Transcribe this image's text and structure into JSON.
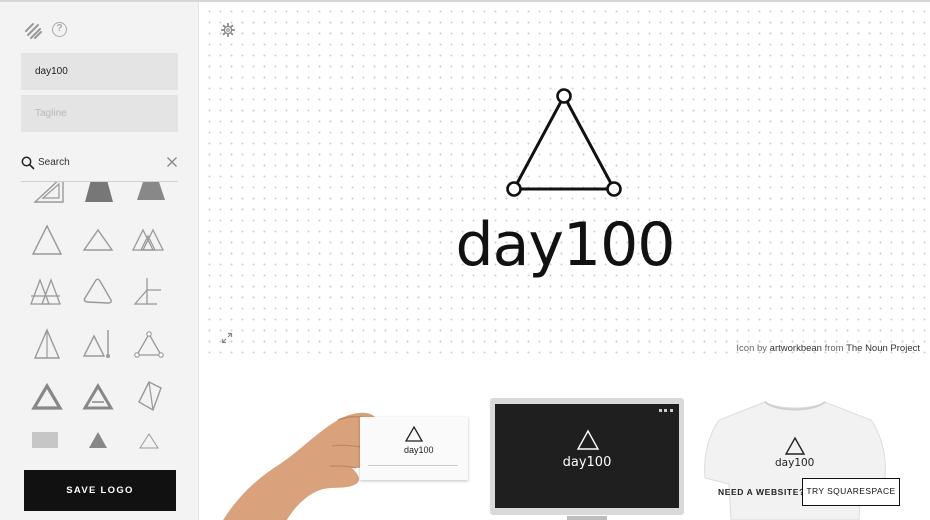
{
  "sidebar": {
    "brand_icon": "squarespace-logo-icon",
    "help_label": "?",
    "logo_name_value": "day100",
    "tagline_placeholder": "Tagline",
    "search_label": "Search",
    "save_label": "SAVE LOGO",
    "icon_grid": [
      "triangle-ruler-icon",
      "solid-trapezoid-icon",
      "solid-triangle-icon",
      "triangle-outline-icon",
      "triangle-outline-wide-icon",
      "overlapping-triangles-icon",
      "stacked-triangles-icon",
      "rounded-triangle-icon",
      "triangle-corner-icon",
      "split-triangle-icon",
      "triangle-measure-icon",
      "triangle-nodes-icon",
      "bold-triangle-icon",
      "bold-triangle-alt-icon",
      "triangular-prism-icon",
      "barcode-triangle-icon",
      "small-solid-triangle-icon",
      "thin-triangle-icon"
    ]
  },
  "canvas": {
    "logo_text": "day100",
    "logo_icon": "triangle-nodes-icon",
    "credit_prefix": "Icon by",
    "credit_author": "artworkbean",
    "credit_from": "from",
    "credit_source": "The Noun Project"
  },
  "previews": {
    "card_name": "day100",
    "screen_name": "day100",
    "shirt_name": "day100",
    "need_website": "NEED A WEBSITE?",
    "try_button": "TRY SQUARESPACE"
  },
  "colors": {
    "sidebar_bg": "#f3f3f3",
    "save_button_bg": "#111111",
    "field_bg": "#e4e4e4"
  }
}
